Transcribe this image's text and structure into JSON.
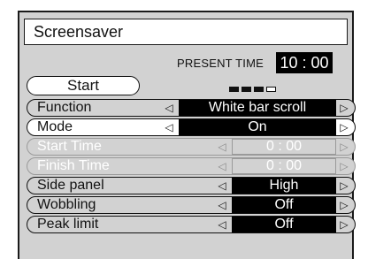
{
  "title": "Screensaver",
  "present_time": {
    "label": "PRESENT TIME",
    "value": "10 : 00"
  },
  "start_button": "Start",
  "rows": [
    {
      "label": "Function",
      "value": "White bar scroll"
    },
    {
      "label": "Mode",
      "value": "On"
    },
    {
      "label": "Start Time",
      "value": "0 : 00"
    },
    {
      "label": "Finish Time",
      "value": "0 : 00"
    },
    {
      "label": "Side  panel",
      "value": "High"
    },
    {
      "label": "Wobbling",
      "value": "Off"
    },
    {
      "label": "Peak limit",
      "value": "Off"
    }
  ],
  "arrows": {
    "left": "◁",
    "right": "▷"
  },
  "colors": {
    "panel": "#d2d2d2",
    "value_bg": "#000000",
    "disabled": "#9a9a9a"
  }
}
